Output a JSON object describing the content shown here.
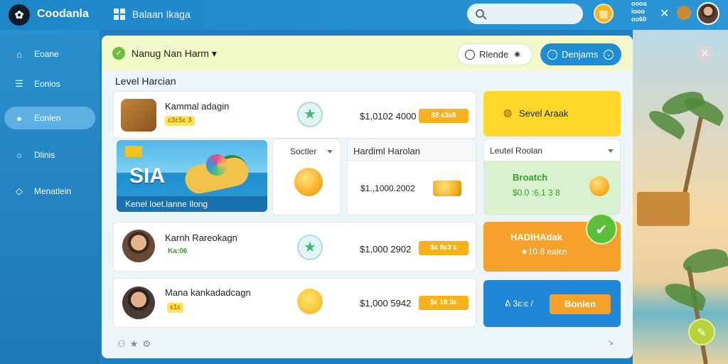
{
  "header": {
    "logo_glyph": "✿",
    "brand": "Coodanla",
    "breadcrumb": "Balaan Ikaga",
    "stats_line1": "oooa",
    "stats_line2": "iooo",
    "stats_line3": "oo60"
  },
  "sidebar": {
    "items": [
      {
        "label": "Eoane",
        "icon": "home-icon"
      },
      {
        "label": "Eonios",
        "icon": "list-icon"
      },
      {
        "label": "Eonlen",
        "icon": "user-icon"
      },
      {
        "label": "Dlinis",
        "icon": "search-icon"
      },
      {
        "label": "Menatlein",
        "icon": "diamond-icon"
      }
    ]
  },
  "panel": {
    "title": "Nanug Nan Harm ▾",
    "btn_light": "Rlende",
    "btn_blue": "Denjams",
    "section_title": "Level Harcian"
  },
  "rows": [
    {
      "name": "Kammal adagin",
      "tag": "ε3ε5ε 3",
      "amount": "$1,0102 4000",
      "chip": "$8 ɛ3ɛ8"
    },
    {
      "name": "Karnh Rareokagn",
      "tag": "Ka:06",
      "amount": "$1,000 2902",
      "chip": "$ɛ 8ɛ3 ɛ"
    },
    {
      "name": "Mana kankadadcagn",
      "tag": "ε1ε",
      "amount": "$1,000 5942",
      "chip": "$ɛ 18 3ɛ"
    }
  ],
  "banner": {
    "big_text": "SIA",
    "caption": "Kenel Ioet.lanne Ilong"
  },
  "mid": {
    "dropdown_label": "Soctler",
    "harcian_title": "Hardiml Harolan",
    "harcian_amount": "$1.,1000.2002"
  },
  "right_cards": {
    "level_label": "Sevel Araak",
    "dropdown_label": "Leutel Roolan",
    "green_title": "Broatch",
    "green_value": "$0.0 :6.1 3 8",
    "orange_title": "HADIHAdak",
    "orange_value": "★10 8 ealɛn",
    "blue_left": "ᕕ 3ɛ:c /",
    "blue_btn": "Bonlen"
  },
  "colors": {
    "accent": "#1d8dd6",
    "gold": "#f6b21a",
    "orange": "#f5a12b",
    "green": "#d8f2cf",
    "yellow": "#ffd82a"
  }
}
